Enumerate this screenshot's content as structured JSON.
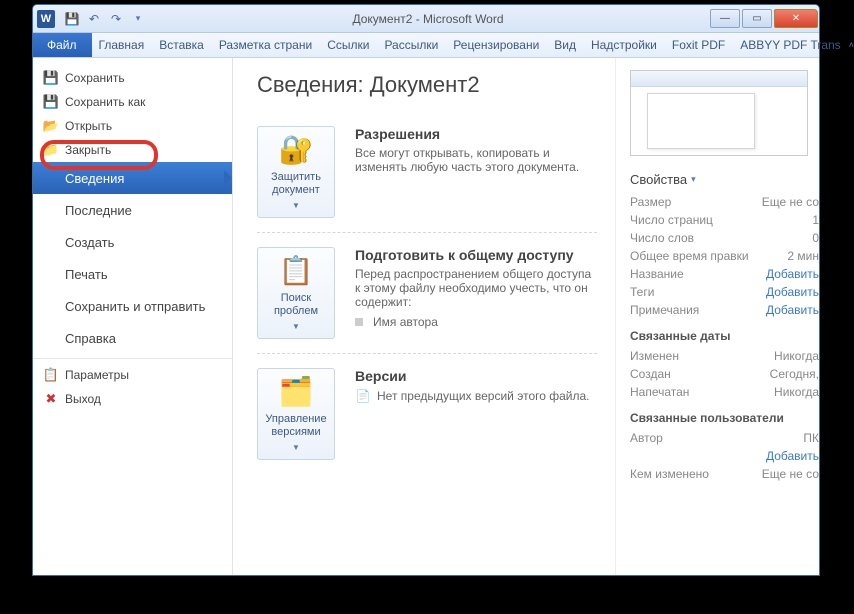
{
  "title": "Документ2 - Microsoft Word",
  "ribbon": {
    "file": "Файл",
    "tabs": [
      "Главная",
      "Вставка",
      "Разметка страни",
      "Ссылки",
      "Рассылки",
      "Рецензировани",
      "Вид",
      "Надстройки",
      "Foxit PDF",
      "ABBYY PDF Trans"
    ]
  },
  "side": {
    "save": "Сохранить",
    "saveas": "Сохранить как",
    "open": "Открыть",
    "close": "Закрыть",
    "info": "Сведения",
    "recent": "Последние",
    "new": "Создать",
    "print": "Печать",
    "share": "Сохранить и отправить",
    "help": "Справка",
    "options": "Параметры",
    "exit": "Выход"
  },
  "info": {
    "heading": "Сведения: Документ2",
    "permissions": {
      "title": "Разрешения",
      "desc": "Все могут открывать, копировать и изменять любую часть этого документа.",
      "btn": "Защитить документ"
    },
    "prepare": {
      "title": "Подготовить к общему доступу",
      "desc": "Перед распространением общего доступа к этому файлу необходимо учесть, что он содержит:",
      "bullet1": "Имя автора",
      "btn": "Поиск проблем"
    },
    "versions": {
      "title": "Версии",
      "desc": "Нет предыдущих версий этого файла.",
      "btn": "Управление версиями"
    }
  },
  "props": {
    "label": "Свойства",
    "size_k": "Размер",
    "size_v": "Еще не со",
    "pages_k": "Число страниц",
    "pages_v": "1",
    "words_k": "Число слов",
    "words_v": "0",
    "edit_k": "Общее время правки",
    "edit_v": "2 мин",
    "titlep_k": "Название",
    "titlep_v": "Добавить",
    "tags_k": "Теги",
    "tags_v": "Добавить",
    "comm_k": "Примечания",
    "comm_v": "Добавить",
    "dates_h": "Связанные даты",
    "mod_k": "Изменен",
    "mod_v": "Никогда",
    "crt_k": "Создан",
    "crt_v": "Сегодня,",
    "prt_k": "Напечатан",
    "prt_v": "Никогда",
    "users_h": "Связанные пользователи",
    "auth_k": "Автор",
    "auth_v": "ПК",
    "auth_add": "Добавить",
    "chg_k": "Кем изменено",
    "chg_v": "Еще не со"
  }
}
